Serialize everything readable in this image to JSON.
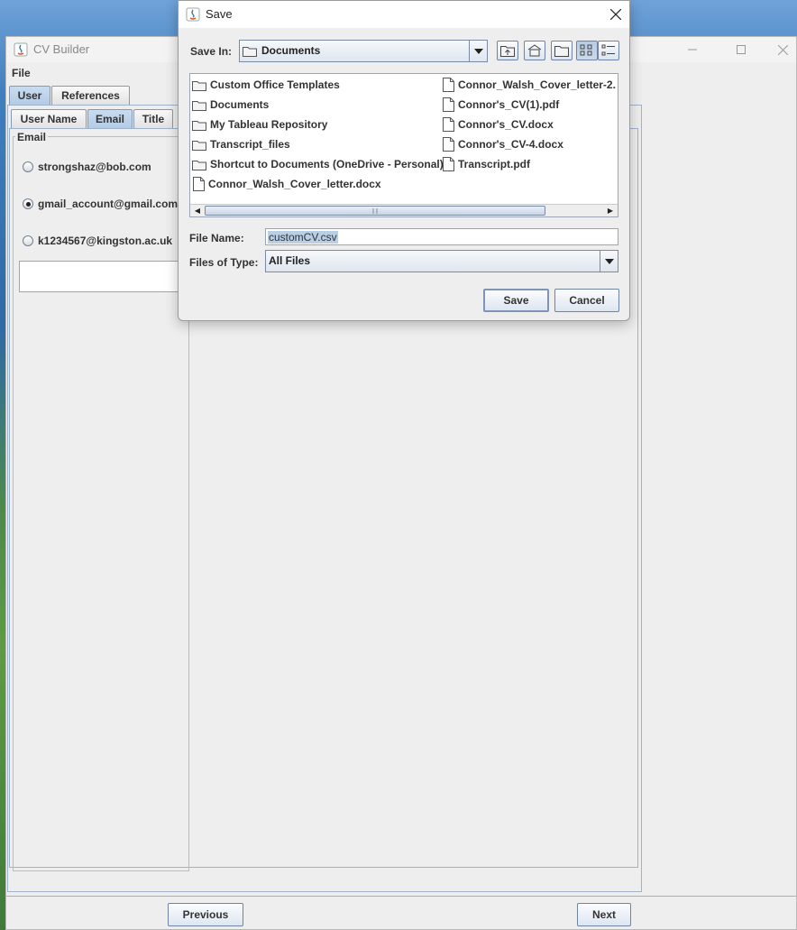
{
  "main_window": {
    "title": "CV Builder",
    "menu": {
      "file": "File"
    },
    "outer_tabs": [
      "User",
      "References"
    ],
    "inner_tabs": [
      "User Name",
      "Email",
      "Title"
    ],
    "email_group": {
      "legend": "Email",
      "options": [
        {
          "label": "strongshaz@bob.com",
          "selected": false
        },
        {
          "label": "gmail_account@gmail.com",
          "selected": true
        },
        {
          "label": "k1234567@kingston.ac.uk",
          "selected": false
        }
      ]
    },
    "buttons": {
      "previous": "Previous",
      "next": "Next"
    }
  },
  "save_dialog": {
    "title": "Save",
    "save_in_label": "Save In:",
    "save_in_value": "Documents",
    "files": [
      {
        "name": "Custom Office Templates",
        "type": "folder"
      },
      {
        "name": "Documents",
        "type": "folder"
      },
      {
        "name": "My Tableau Repository",
        "type": "folder"
      },
      {
        "name": "Transcript_files",
        "type": "folder"
      },
      {
        "name": "Shortcut to Documents (OneDrive - Personal)",
        "type": "folder"
      },
      {
        "name": "Connor_Walsh_Cover_letter.docx",
        "type": "file"
      },
      {
        "name": "Connor_Walsh_Cover_letter-2.",
        "type": "file"
      },
      {
        "name": "Connor's_CV(1).pdf",
        "type": "file"
      },
      {
        "name": "Connor's_CV.docx",
        "type": "file"
      },
      {
        "name": "Connor's_CV-4.docx",
        "type": "file"
      },
      {
        "name": "Transcript.pdf",
        "type": "file"
      }
    ],
    "file_name_label": "File Name:",
    "file_name_value": "customCV.csv",
    "files_of_type_label": "Files of Type:",
    "files_of_type_value": "All Files",
    "save_button": "Save",
    "cancel_button": "Cancel"
  }
}
